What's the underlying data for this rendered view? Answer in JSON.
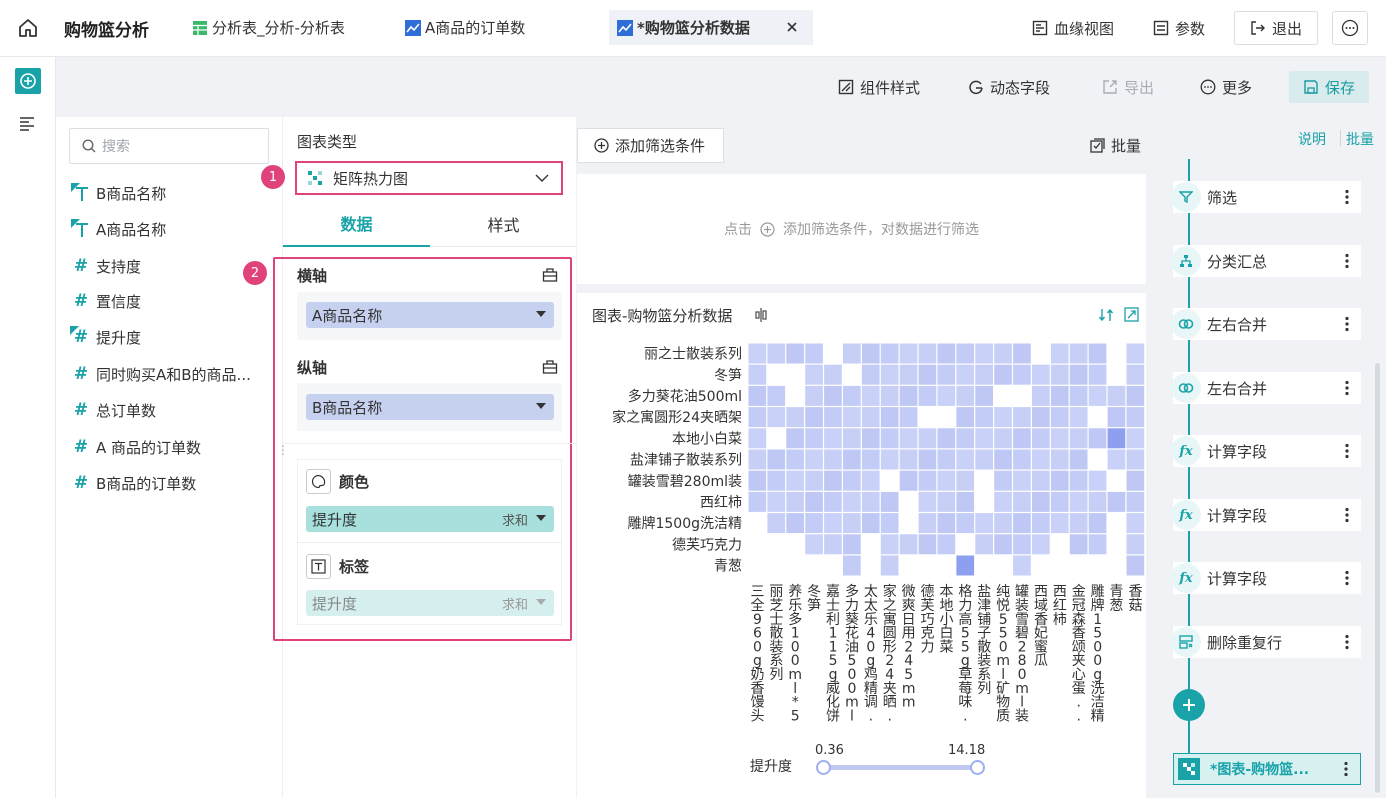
{
  "header": {
    "home_icon": "home-icon",
    "title": "购物篮分析",
    "tabs": [
      {
        "label": "分析表_分析-分析表",
        "icon": "table-icon"
      },
      {
        "label": "A商品的订单数",
        "icon": "chart-icon"
      },
      {
        "label": "*购物篮分析数据",
        "icon": "chart-icon",
        "active": true
      }
    ],
    "actions": [
      {
        "label": "血缘视图",
        "icon": "lineage-icon"
      },
      {
        "label": "参数",
        "icon": "param-icon"
      },
      {
        "label": "退出",
        "icon": "exit-icon"
      }
    ]
  },
  "toolbar": {
    "component_style": "组件样式",
    "dynamic_field": "动态字段",
    "export": "导出",
    "more": "更多",
    "save": "保存"
  },
  "fields": {
    "search_placeholder": "搜索",
    "items": [
      {
        "label": "B商品名称",
        "type": "text",
        "marked": true
      },
      {
        "label": "A商品名称",
        "type": "text",
        "marked": true
      },
      {
        "label": "支持度",
        "type": "number"
      },
      {
        "label": "置信度",
        "type": "number"
      },
      {
        "label": "提升度",
        "type": "number",
        "marked": true
      },
      {
        "label": "同时购买A和B的商品...",
        "type": "number"
      },
      {
        "label": "总订单数",
        "type": "number"
      },
      {
        "label": "A 商品的订单数",
        "type": "number"
      },
      {
        "label": "B商品的订单数",
        "type": "number"
      }
    ]
  },
  "config": {
    "chart_type_label": "图表类型",
    "chart_type_value": "矩阵热力图",
    "tab_data": "数据",
    "tab_style": "样式",
    "markers": [
      "1",
      "2"
    ],
    "x_axis_label": "横轴",
    "x_axis_field": "A商品名称",
    "y_axis_label": "纵轴",
    "y_axis_field": "B商品名称",
    "color_label": "颜色",
    "color_field": "提升度",
    "color_agg": "求和",
    "tag_label": "标签",
    "tag_field": "提升度",
    "tag_agg": "求和"
  },
  "filter": {
    "add_button": "添加筛选条件",
    "batch": "批量",
    "hint_click": "点击",
    "hint_text": "添加筛选条件，对数据进行筛选"
  },
  "chart": {
    "title": "图表-购物篮分析数据",
    "legend_label": "提升度",
    "legend_min": "0.36",
    "legend_max": "14.18"
  },
  "chart_data": {
    "type": "heatmap",
    "y_categories": [
      "丽之士散装系列",
      "冬笋",
      "多力葵花油500ml",
      "家之寓圆形24夹晒架",
      "本地小白菜",
      "盐津铺子散装系列",
      "罐装雪碧280ml装",
      "西红柿",
      "雕牌1500g洗洁精",
      "德芙巧克力",
      "青葱"
    ],
    "x_categories": [
      "三全960g奶香馒头",
      "丽芝士散装系列",
      "养乐多100ml*5乳...",
      "冬笋",
      "嘉士利115g威化饼",
      "多力葵花油500ml",
      "太太乐40g鸡精调...",
      "家之寓圆形24夹晒...",
      "微爽日用245mm",
      "德芙巧克力",
      "本地小白菜",
      "格力高55g草莓味...",
      "盐津铺子散装系列",
      "纯悦550ml矿物质水",
      "罐装雪碧280ml装",
      "西域香妃蜜瓜",
      "西红柿",
      "金冠森香颂夹心蛋...",
      "雕牌1500g洗洁精",
      "青葱",
      "香菇"
    ],
    "colorbar_range": [
      0.36,
      14.18
    ],
    "colorbar_label": "提升度"
  },
  "pipeline": {
    "explain": "说明",
    "batch": "批量",
    "steps": [
      {
        "label": "筛选",
        "icon": "filter-icon"
      },
      {
        "label": "分类汇总",
        "icon": "group-icon"
      },
      {
        "label": "左右合并",
        "icon": "merge-icon"
      },
      {
        "label": "左右合并",
        "icon": "merge-icon"
      },
      {
        "label": "计算字段",
        "icon": "fx-icon"
      },
      {
        "label": "计算字段",
        "icon": "fx-icon"
      },
      {
        "label": "计算字段",
        "icon": "fx-icon"
      },
      {
        "label": "删除重复行",
        "icon": "dedupe-icon"
      }
    ],
    "active_step": "*图表-购物篮..."
  }
}
